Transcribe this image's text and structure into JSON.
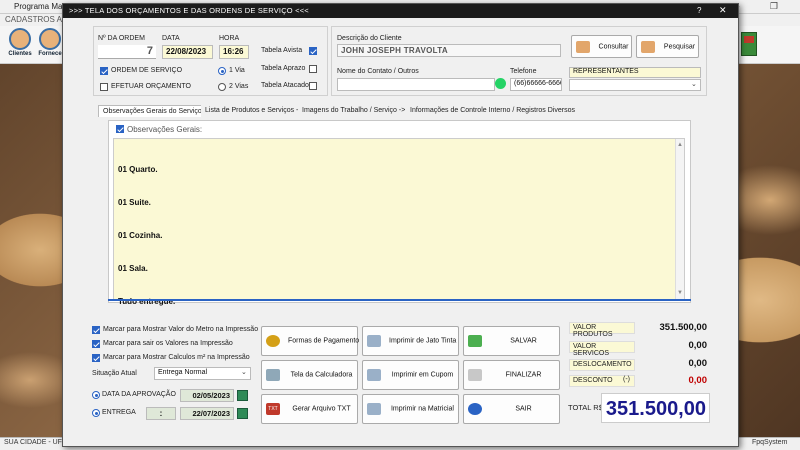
{
  "outer": {
    "title": "Programa Marc",
    "menu": "CADASTROS   AR",
    "tool_clientes": "Clientes",
    "tool_fornece": "Fornece",
    "status_left": "SUA CIDADE - UF 2",
    "status_right": "FpqSystem",
    "window_controls": "— ❐"
  },
  "window": {
    "title": ">>>  TELA DOS ORÇAMENTOS E DAS ORDENS DE SERVIÇO  <<<",
    "help": "?",
    "close": "✕"
  },
  "order": {
    "num_label": "Nº DA ORDEM",
    "num_value": "7",
    "date_label": "DATA",
    "date_value": "22/08/2023",
    "hour_label": "HORA",
    "hour_value": "16:26",
    "os_label": "ORDEM DE SERVIÇO",
    "orc_label": "EFETUAR ORÇAMENTO",
    "via1": "1 Via",
    "via2": "2 Vias",
    "tab_avista": "Tabela Avista",
    "tab_aprazo": "Tabela Aprazo",
    "tab_atacado": "Tabela Atacado"
  },
  "client": {
    "desc_label": "Descrição do Cliente",
    "desc_value": "JOHN JOSEPH TRAVOLTA",
    "contact_label": "Nome do Contato / Outros",
    "contact_value": "",
    "phone_label": "Telefone",
    "phone_value": "(66)66666-6666",
    "consult": "Consultar",
    "search": "Pesquisar",
    "rep_label": "REPRESENTANTES",
    "rep_value": ""
  },
  "tabs": [
    "Observações Gerais do Serviço ->",
    "Lista de Produtos e Serviços ->",
    "Imagens do Trabalho / Serviço ->",
    "Informações de Controle Interno / Registros Diversos"
  ],
  "obs": {
    "header": "Observações Gerais:",
    "lines": [
      "01 Quarto.",
      "01 Suite.",
      "01 Cozinha.",
      "01 Sala.",
      "Tudo entregue."
    ]
  },
  "options": {
    "opt1": "Marcar para Mostrar Valor do Metro na Impressão",
    "opt2": "Marcar para sair os Valores na Impressão",
    "opt3": "Marcar para Mostrar Calculos m² na Impressão",
    "situacao_label": "Situação Atual",
    "situacao_value": "Entrega Normal",
    "aprov_label": "DATA DA APROVAÇÃO",
    "aprov_value": "02/05/2023",
    "entrega_label": "ENTREGA",
    "entrega_sep": ":",
    "entrega_value": "22/07/2023"
  },
  "buttons": {
    "pagamento": "Formas de Pagamento",
    "jato": "Imprimir de Jato Tinta",
    "salvar": "SALVAR",
    "calculadora": "Tela da Calculadora",
    "cupom": "Imprimir em Cupom",
    "finalizar": "FINALIZAR",
    "txt": "Gerar Arquivo TXT",
    "txt_icon_text": "TXT",
    "matricial": "Imprimir na Matricial",
    "sair": "SAIR"
  },
  "summary": {
    "produtos_label": "VALOR PRODUTOS",
    "produtos_value": "351.500,00",
    "servicos_label": "VALOR SERVICOS",
    "servicos_value": "0,00",
    "desloc_label": "DESLOCAMENTO",
    "desloc_value": "0,00",
    "desconto_label": "DESCONTO",
    "desconto_sign": "(-)",
    "desconto_value": "0,00",
    "total_label": "TOTAL R$",
    "total_value": "351.500,00"
  },
  "colors": {
    "total": "#1a1a8c",
    "desconto": "#c00000",
    "accent": "#2a63c4"
  }
}
